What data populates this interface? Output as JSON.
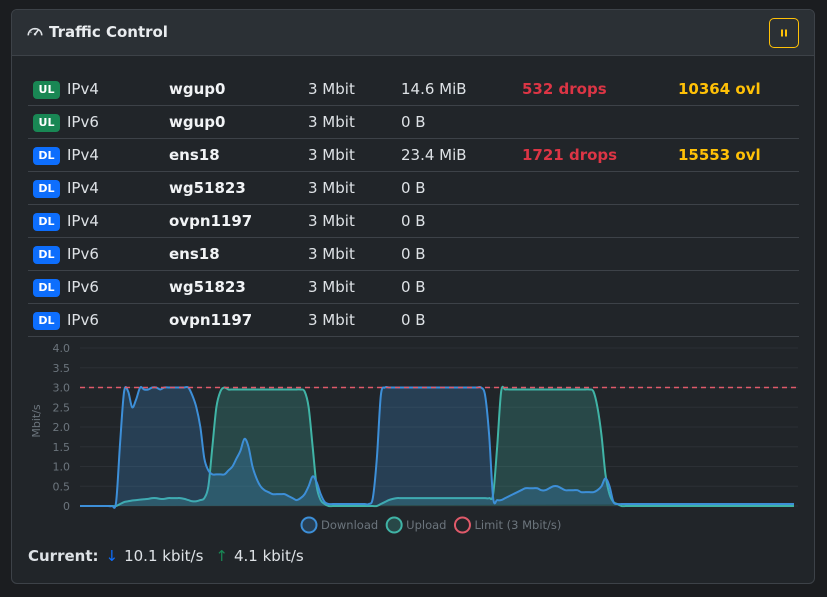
{
  "header": {
    "title": "Traffic Control",
    "icon": "speedometer-icon",
    "pause_icon": "pause-icon",
    "pause_label": "⏸"
  },
  "colors": {
    "ul": "#198754",
    "dl": "#0d6efd",
    "drops": "#dc3545",
    "ovl": "#ffc107",
    "download": "#3d8fd8",
    "upload": "#40b4a6",
    "limit": "#e05a6a"
  },
  "rows": [
    {
      "dir": "UL",
      "proto": "IPv4",
      "iface": "wgup0",
      "rate": "3 Mbit",
      "bytes": "14.6 MiB",
      "drops": "532 drops",
      "ovl": "10364 ovl"
    },
    {
      "dir": "UL",
      "proto": "IPv6",
      "iface": "wgup0",
      "rate": "3 Mbit",
      "bytes": "0 B",
      "drops": "",
      "ovl": ""
    },
    {
      "dir": "DL",
      "proto": "IPv4",
      "iface": "ens18",
      "rate": "3 Mbit",
      "bytes": "23.4 MiB",
      "drops": "1721 drops",
      "ovl": "15553 ovl"
    },
    {
      "dir": "DL",
      "proto": "IPv4",
      "iface": "wg51823",
      "rate": "3 Mbit",
      "bytes": "0 B",
      "drops": "",
      "ovl": ""
    },
    {
      "dir": "DL",
      "proto": "IPv4",
      "iface": "ovpn1197",
      "rate": "3 Mbit",
      "bytes": "0 B",
      "drops": "",
      "ovl": ""
    },
    {
      "dir": "DL",
      "proto": "IPv6",
      "iface": "ens18",
      "rate": "3 Mbit",
      "bytes": "0 B",
      "drops": "",
      "ovl": ""
    },
    {
      "dir": "DL",
      "proto": "IPv6",
      "iface": "wg51823",
      "rate": "3 Mbit",
      "bytes": "0 B",
      "drops": "",
      "ovl": ""
    },
    {
      "dir": "DL",
      "proto": "IPv6",
      "iface": "ovpn1197",
      "rate": "3 Mbit",
      "bytes": "0 B",
      "drops": "",
      "ovl": ""
    }
  ],
  "chart_data": {
    "type": "area",
    "ylabel": "Mbit/s",
    "ylim": [
      0,
      4.0
    ],
    "yticks": [
      "0",
      "0.5",
      "1.0",
      "1.5",
      "2.0",
      "2.5",
      "3.0",
      "3.5",
      "4.0"
    ],
    "grid": true,
    "legend_position": "bottom",
    "limit": {
      "name": "Limit (3 Mbit/s)",
      "value": 3.0
    },
    "x": [
      0,
      1,
      2,
      3,
      4,
      5,
      6,
      7,
      8,
      9,
      10,
      11,
      12,
      13,
      14,
      15,
      16,
      17,
      18,
      19,
      20,
      21,
      22,
      23,
      24,
      25,
      26,
      27,
      28,
      29,
      30,
      31,
      32,
      33,
      34,
      35,
      36,
      37,
      38,
      39,
      40,
      41,
      42,
      43,
      44,
      45,
      46,
      47,
      48,
      49,
      50,
      51,
      52,
      53,
      54,
      55,
      56,
      57,
      58,
      59,
      60,
      61,
      62,
      63,
      64,
      65,
      66,
      67,
      68,
      69,
      70,
      71,
      72,
      73,
      74,
      75,
      76,
      77,
      78,
      79,
      80,
      81,
      82,
      83,
      84,
      85,
      86,
      87,
      88,
      89,
      90,
      91,
      92,
      93,
      94,
      95,
      96,
      97,
      98,
      99,
      100,
      101,
      102,
      103,
      104,
      105,
      106,
      107,
      108,
      109,
      110,
      111,
      112,
      113,
      114,
      115,
      116,
      117,
      118,
      119,
      120,
      121,
      122,
      123,
      124,
      125,
      126,
      127,
      128,
      129,
      130,
      131,
      132,
      133,
      134,
      135,
      136,
      137,
      138,
      139,
      140,
      141,
      142,
      143,
      144,
      145,
      146,
      147,
      148,
      149,
      150,
      151,
      152,
      153,
      154,
      155,
      156,
      157,
      158,
      159,
      160,
      161,
      162,
      163,
      164,
      165,
      166,
      167,
      168,
      169,
      170,
      171,
      172,
      173,
      174,
      175,
      176,
      177,
      178,
      179
    ],
    "series": [
      {
        "name": "Download",
        "values": [
          0,
          0,
          0,
          0,
          0,
          0,
          0,
          0,
          0,
          0.1,
          1.6,
          2.9,
          2.9,
          2.5,
          2.7,
          3.0,
          2.95,
          2.95,
          3.0,
          3.0,
          2.95,
          3.0,
          3.0,
          3.0,
          3.0,
          3.0,
          3.0,
          3.0,
          2.8,
          2.5,
          2.0,
          1.2,
          0.9,
          0.8,
          0.8,
          0.8,
          0.8,
          0.9,
          1.0,
          1.2,
          1.4,
          1.7,
          1.5,
          1.0,
          0.7,
          0.5,
          0.4,
          0.35,
          0.3,
          0.3,
          0.3,
          0.3,
          0.25,
          0.2,
          0.15,
          0.2,
          0.3,
          0.5,
          0.75,
          0.6,
          0.3,
          0.1,
          0.05,
          0.05,
          0.05,
          0.05,
          0.05,
          0.05,
          0.05,
          0.05,
          0.05,
          0.05,
          0.05,
          0.2,
          1.2,
          2.8,
          3.0,
          3.0,
          3.0,
          3.0,
          3.0,
          3.0,
          3.0,
          3.0,
          3.0,
          3.0,
          3.0,
          3.0,
          3.0,
          3.0,
          3.0,
          3.0,
          3.0,
          3.0,
          3.0,
          3.0,
          3.0,
          3.0,
          3.0,
          3.0,
          3.0,
          2.8,
          1.8,
          0.2,
          0.15,
          0.15,
          0.2,
          0.25,
          0.3,
          0.35,
          0.4,
          0.45,
          0.45,
          0.45,
          0.45,
          0.4,
          0.4,
          0.45,
          0.5,
          0.5,
          0.45,
          0.4,
          0.4,
          0.4,
          0.4,
          0.35,
          0.35,
          0.35,
          0.35,
          0.4,
          0.5,
          0.7,
          0.5,
          0.1,
          0.05,
          0.05,
          0.05,
          0.05,
          0.05,
          0.05,
          0.05,
          0.05,
          0.05,
          0.05,
          0.05,
          0.05,
          0.05,
          0.05,
          0.05,
          0.05,
          0.05,
          0.05,
          0.05,
          0.05,
          0.05,
          0.05,
          0.05,
          0.05,
          0.05,
          0.05,
          0.05,
          0.05,
          0.05,
          0.05,
          0.05,
          0.05,
          0.05,
          0.05,
          0.05,
          0.05,
          0.05,
          0.05,
          0.05,
          0.05,
          0.05,
          0.05,
          0.05,
          0.05,
          0.05,
          0.05,
          0.05,
          0.05,
          0.05,
          0.05
        ]
      },
      {
        "name": "Upload",
        "values": [
          0,
          0,
          0,
          0,
          0,
          0,
          0,
          0,
          0,
          0,
          0.05,
          0.1,
          0.12,
          0.14,
          0.15,
          0.16,
          0.17,
          0.18,
          0.2,
          0.2,
          0.18,
          0.18,
          0.2,
          0.2,
          0.2,
          0.2,
          0.18,
          0.15,
          0.12,
          0.12,
          0.15,
          0.2,
          0.5,
          1.5,
          2.5,
          2.9,
          3.0,
          2.95,
          2.95,
          2.95,
          2.95,
          2.95,
          2.95,
          2.95,
          2.95,
          2.95,
          2.95,
          2.95,
          2.95,
          2.95,
          2.95,
          2.95,
          2.95,
          2.95,
          2.95,
          2.95,
          2.9,
          2.5,
          1.5,
          0.5,
          0.15,
          0.05,
          0,
          0,
          0,
          0,
          0,
          0,
          0,
          0,
          0,
          0,
          0,
          0,
          0,
          0.05,
          0.1,
          0.15,
          0.18,
          0.2,
          0.2,
          0.2,
          0.2,
          0.2,
          0.2,
          0.2,
          0.2,
          0.2,
          0.2,
          0.2,
          0.2,
          0.2,
          0.2,
          0.2,
          0.2,
          0.2,
          0.2,
          0.2,
          0.2,
          0.2,
          0.2,
          0.2,
          0.2,
          0.3,
          1.5,
          2.9,
          2.95,
          2.95,
          2.95,
          2.95,
          2.95,
          2.95,
          2.95,
          2.95,
          2.95,
          2.95,
          2.95,
          2.95,
          2.95,
          2.95,
          2.95,
          2.95,
          2.95,
          2.95,
          2.95,
          2.95,
          2.95,
          2.95,
          2.9,
          2.5,
          1.8,
          0.8,
          0.3,
          0.1,
          0.05,
          0,
          0,
          0,
          0,
          0,
          0,
          0,
          0,
          0,
          0,
          0,
          0,
          0,
          0,
          0,
          0,
          0,
          0,
          0,
          0,
          0,
          0,
          0,
          0,
          0,
          0,
          0,
          0,
          0,
          0,
          0,
          0,
          0,
          0,
          0,
          0,
          0,
          0,
          0,
          0,
          0,
          0,
          0,
          0,
          0,
          0,
          0,
          0,
          0,
          0
        ]
      }
    ],
    "legend": [
      "Download",
      "Upload",
      "Limit (3 Mbit/s)"
    ]
  },
  "current": {
    "label": "Current:",
    "down_arrow": "↓",
    "down_value": "10.1 kbit/s",
    "up_arrow": "↑",
    "up_value": "4.1 kbit/s"
  }
}
